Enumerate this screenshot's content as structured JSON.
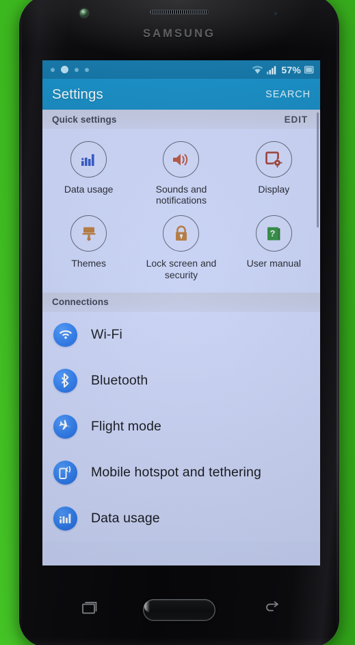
{
  "device": {
    "brand": "SAMSUNG",
    "hardware": {
      "earpiece": "earpiece-speaker",
      "front_camera": "front-camera",
      "proximity_sensor": "proximity-sensor",
      "home_button": "home-button",
      "recents_key": "recents-key",
      "back_key": "back-key"
    }
  },
  "status_bar": {
    "notification_dots": 4,
    "wifi_icon": "wifi-icon",
    "signal_icon": "signal-bars-icon",
    "battery_text": "57%",
    "battery_icon": "battery-icon"
  },
  "app_bar": {
    "title": "Settings",
    "search_label": "SEARCH"
  },
  "quick_settings": {
    "header": "Quick settings",
    "edit_label": "EDIT",
    "items": [
      {
        "label": "Data usage",
        "icon": "data-usage-icon",
        "color": "#2f56c8"
      },
      {
        "label": "Sounds and notifications",
        "icon": "sound-volume-icon",
        "color": "#b4533f"
      },
      {
        "label": "Display",
        "icon": "display-settings-icon",
        "color": "#9e3b30"
      },
      {
        "label": "Themes",
        "icon": "themes-brush-icon",
        "color": "#b5793c"
      },
      {
        "label": "Lock screen and security",
        "icon": "lock-icon",
        "color": "#b5793c"
      },
      {
        "label": "User manual",
        "icon": "user-manual-book-icon",
        "color": "#2f8b42"
      }
    ]
  },
  "connections": {
    "header": "Connections",
    "rows": [
      {
        "label": "Wi-Fi",
        "icon": "wifi-icon"
      },
      {
        "label": "Bluetooth",
        "icon": "bluetooth-icon"
      },
      {
        "label": "Flight mode",
        "icon": "airplane-icon"
      },
      {
        "label": "Mobile hotspot and tethering",
        "icon": "mobile-hotspot-icon"
      },
      {
        "label": "Data usage",
        "icon": "data-usage-bars-icon"
      }
    ]
  },
  "theme": {
    "status_bar_color": "#0d74a8",
    "app_bar_color": "#128fc9",
    "background_color": "#ccd6f8",
    "row_icon_color": "#2f7ef0",
    "backdrop_color": "#3fbf21"
  }
}
